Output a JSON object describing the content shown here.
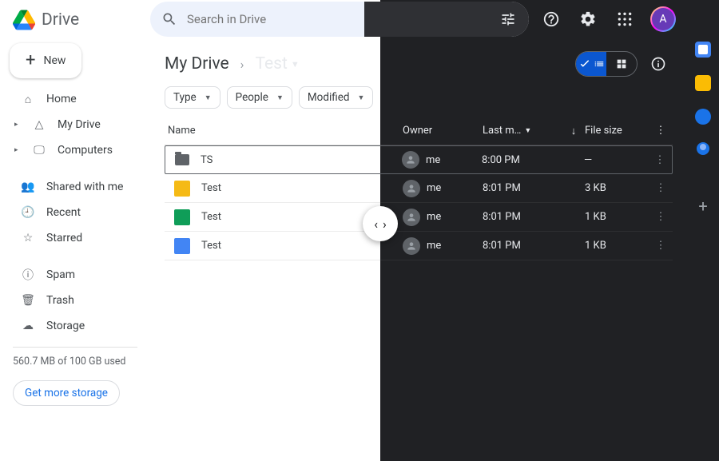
{
  "app": {
    "name": "Drive"
  },
  "new_button": "New",
  "sidebar": {
    "items": [
      {
        "label": "Home",
        "icon": "home"
      },
      {
        "label": "My Drive",
        "icon": "drive"
      },
      {
        "label": "Computers",
        "icon": "computers"
      },
      {
        "label": "Shared with me",
        "icon": "shared"
      },
      {
        "label": "Recent",
        "icon": "recent"
      },
      {
        "label": "Starred",
        "icon": "starred"
      },
      {
        "label": "Spam",
        "icon": "spam"
      },
      {
        "label": "Trash",
        "icon": "trash"
      },
      {
        "label": "Storage",
        "icon": "storage"
      }
    ],
    "storage_text": "560.7 MB of 100 GB used",
    "get_more": "Get more storage"
  },
  "search": {
    "placeholder": "Search in Drive"
  },
  "breadcrumb": {
    "root": "My Drive",
    "current": "Test"
  },
  "chips": [
    {
      "label": "Type"
    },
    {
      "label": "People"
    },
    {
      "label": "Modified"
    }
  ],
  "columns": {
    "name": "Name",
    "owner": "Owner",
    "modified": "Last m…",
    "size": "File size"
  },
  "avatar_initial": "A",
  "files": [
    {
      "name": "TS",
      "type": "folder",
      "owner": "me",
      "modified": "8:00 PM",
      "size": "—",
      "selected": true
    },
    {
      "name": "Test",
      "type": "slides",
      "owner": "me",
      "modified": "8:01 PM",
      "size": "3 KB"
    },
    {
      "name": "Test",
      "type": "sheets",
      "owner": "me",
      "modified": "8:01 PM",
      "size": "1 KB"
    },
    {
      "name": "Test",
      "type": "docs",
      "owner": "me",
      "modified": "8:01 PM",
      "size": "1 KB"
    }
  ]
}
